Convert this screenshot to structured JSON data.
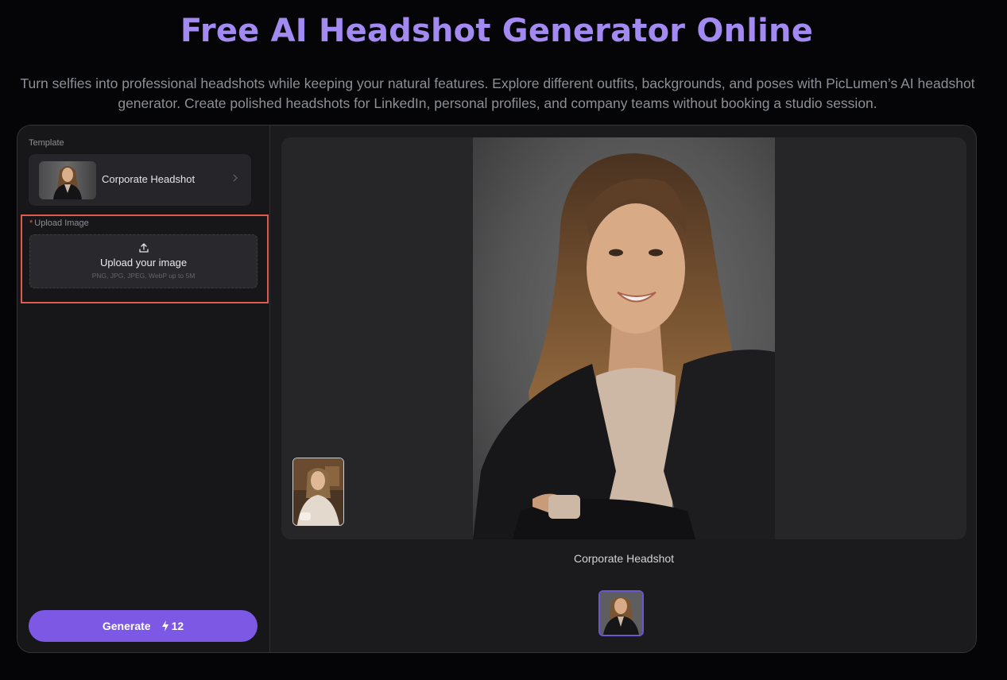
{
  "header": {
    "title": "Free AI Headshot Generator Online",
    "subtitle": "Turn selfies into professional headshots while keeping your natural features. Explore different outfits, backgrounds, and poses with PicLumen’s AI headshot generator. Create polished headshots for LinkedIn, personal profiles, and company teams without booking a studio session."
  },
  "sidebar": {
    "template_label": "Template",
    "template_name": "Corporate Headshot",
    "template_icon": "chevron-right-icon",
    "upload": {
      "required_mark": "*",
      "label": "Upload Image",
      "title": "Upload your image",
      "hint": "PNG, JPG, JPEG, WebP up to 5M",
      "icon": "upload-icon"
    },
    "generate": {
      "label": "Generate",
      "icon": "lightning-bolt-icon",
      "cost": "12"
    }
  },
  "preview": {
    "caption": "Corporate Headshot"
  },
  "colors": {
    "accent": "#7d58e4",
    "title": "#a389f2",
    "highlight": "#e15a50"
  }
}
